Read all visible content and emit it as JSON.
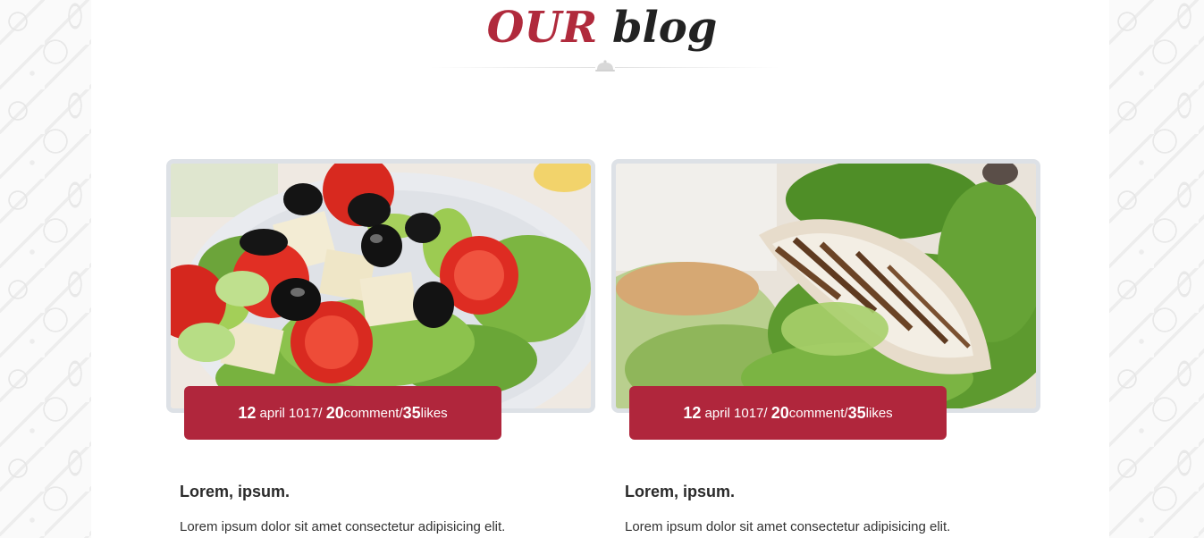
{
  "section": {
    "title_accent": "OUR",
    "title_rest": "blog",
    "divider_icon": "cloche-icon"
  },
  "posts": [
    {
      "image": "greek-salad-photo",
      "day": "12",
      "month_year": "april 1017/",
      "comments_count": "20",
      "comments_label": "comment/",
      "likes_count": "35",
      "likes_label": "likes",
      "title": "Lorem, ipsum.",
      "excerpt": "Lorem ipsum dolor sit amet consectetur adipisicing elit."
    },
    {
      "image": "grilled-chicken-lettuce-photo",
      "day": "12",
      "month_year": "april 1017/",
      "comments_count": "20",
      "comments_label": "comment/",
      "likes_count": "35",
      "likes_label": "likes",
      "title": "Lorem, ipsum.",
      "excerpt": "Lorem ipsum dolor sit amet consectetur adipisicing elit."
    }
  ],
  "colors": {
    "accent": "#b0263c",
    "frame": "#dde1e6",
    "text": "#2a2a2a"
  }
}
